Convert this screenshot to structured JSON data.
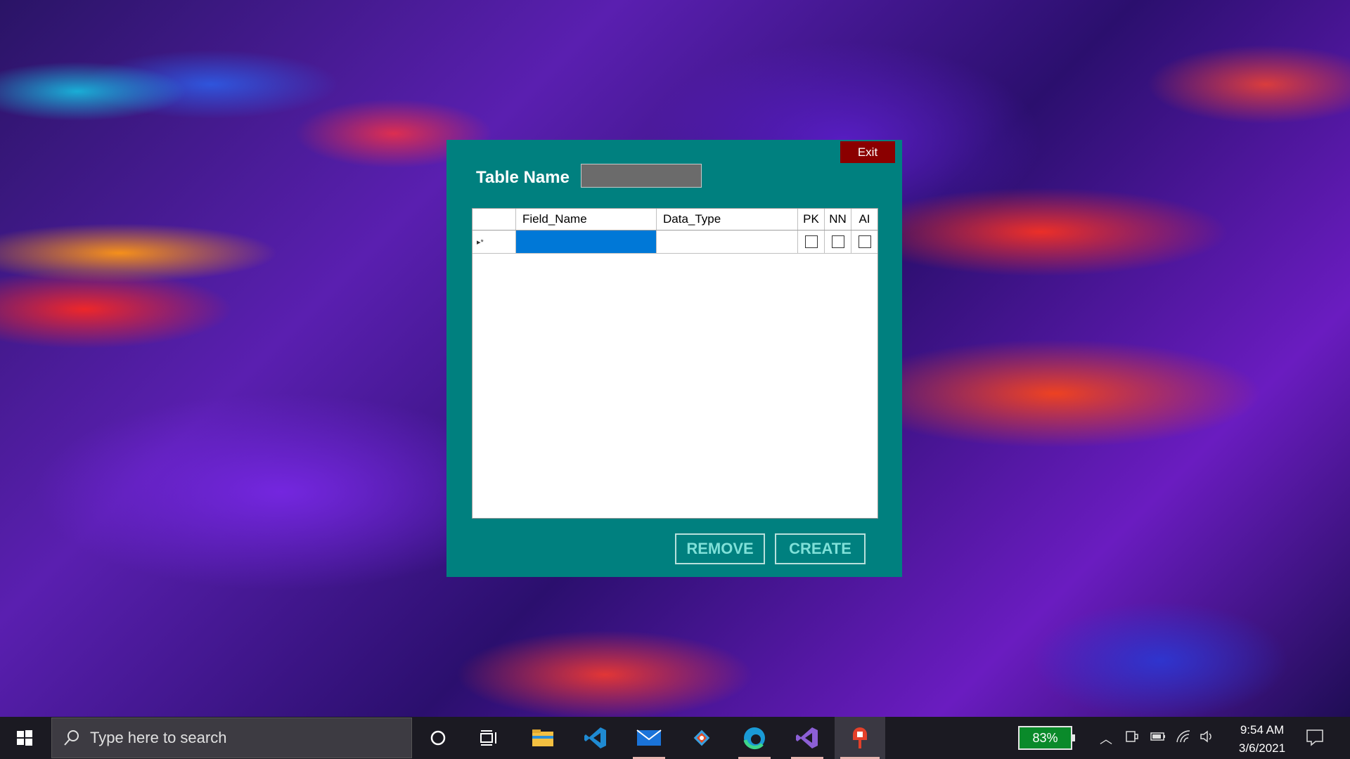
{
  "dialog": {
    "exit_label": "Exit",
    "table_name_label": "Table Name",
    "table_name_value": "",
    "columns": [
      "",
      "Field_Name",
      "Data_Type",
      "PK",
      "NN",
      "AI"
    ],
    "new_row_marker": "▸*",
    "remove_label": "REMOVE",
    "create_label": "CREATE",
    "colors": {
      "dialog_bg": "#00807f",
      "exit_bg": "#8b0000",
      "selected_cell": "#0078d7"
    }
  },
  "taskbar": {
    "search_placeholder": "Type here to search",
    "battery_percent": "83%",
    "time": "9:54 AM",
    "date": "3/6/2021",
    "icons": [
      "windows-start-icon",
      "cortana-icon",
      "task-view-icon",
      "file-explorer-icon",
      "vscode-icon",
      "mail-icon",
      "git-icon",
      "edge-icon",
      "visual-studio-icon",
      "app-icon"
    ]
  }
}
